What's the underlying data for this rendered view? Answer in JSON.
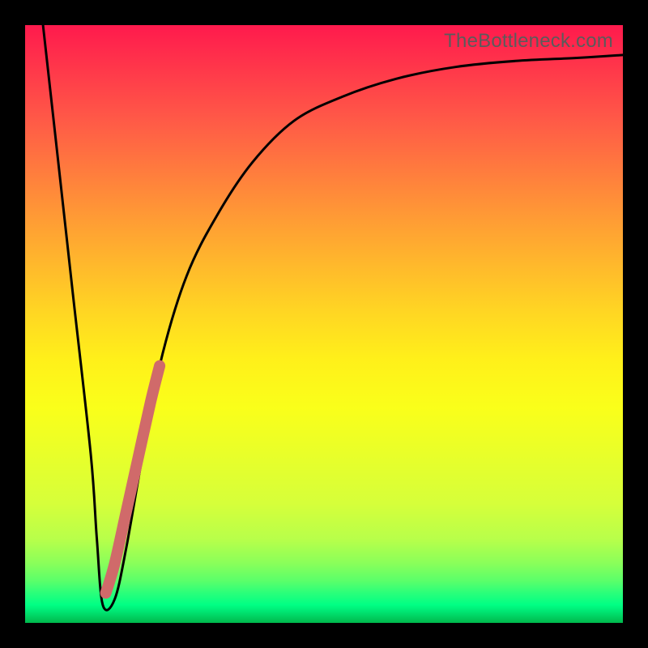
{
  "watermark": "TheBottleneck.com",
  "chart_data": {
    "type": "line",
    "title": "",
    "xlabel": "",
    "ylabel": "",
    "xlim": [
      0,
      100
    ],
    "ylim": [
      0,
      100
    ],
    "grid": false,
    "legend": false,
    "series": [
      {
        "name": "bottleneck-curve",
        "color": "#000000",
        "x": [
          3,
          5,
          8,
          11,
          12,
          13,
          15,
          17,
          20,
          23,
          27,
          32,
          38,
          45,
          53,
          62,
          72,
          82,
          92,
          100
        ],
        "values": [
          100,
          82,
          55,
          28,
          14,
          3,
          4,
          13,
          30,
          45,
          58,
          68,
          77,
          84,
          88,
          91,
          93,
          94,
          94.5,
          95
        ]
      },
      {
        "name": "highlight-segment",
        "color": "#d06a6a",
        "x": [
          13.5,
          15.0,
          17.0,
          19.0,
          21.0,
          22.5
        ],
        "values": [
          5.0,
          10.0,
          19.0,
          28.0,
          37.0,
          43.0
        ]
      }
    ]
  }
}
